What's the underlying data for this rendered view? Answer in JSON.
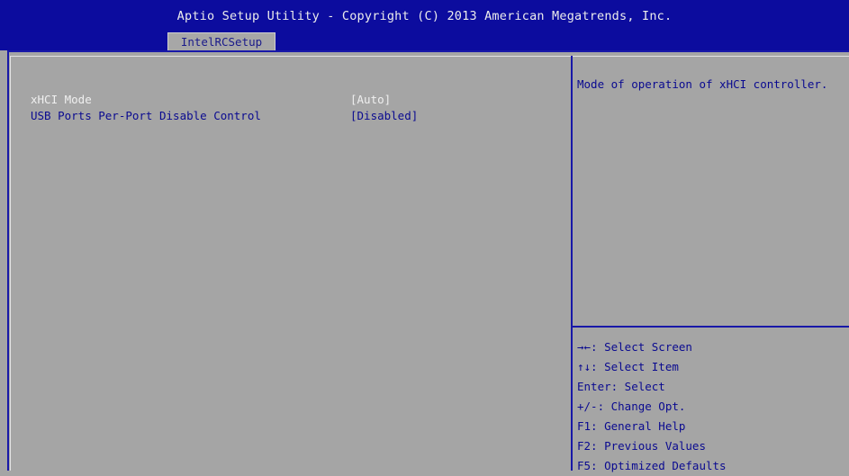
{
  "header": {
    "title": "Aptio Setup Utility - Copyright (C) 2013 American Megatrends, Inc.",
    "tab": "IntelRCSetup"
  },
  "settings": [
    {
      "label": "xHCI Mode",
      "value": "[Auto]"
    },
    {
      "label": "USB Ports Per-Port Disable Control",
      "value": "[Disabled]"
    }
  ],
  "help": {
    "text": "Mode of operation of xHCI controller."
  },
  "keys": [
    "→←: Select Screen",
    "↑↓: Select Item",
    "Enter: Select",
    "+/-: Change Opt.",
    "F1: General Help",
    "F2: Previous Values",
    "F5: Optimized Defaults"
  ],
  "colors": {
    "header_bg": "#0c0c9e",
    "body_bg": "#a5a5a5",
    "text_blue": "#0a0a90",
    "text_selected": "#f0f0f0"
  }
}
